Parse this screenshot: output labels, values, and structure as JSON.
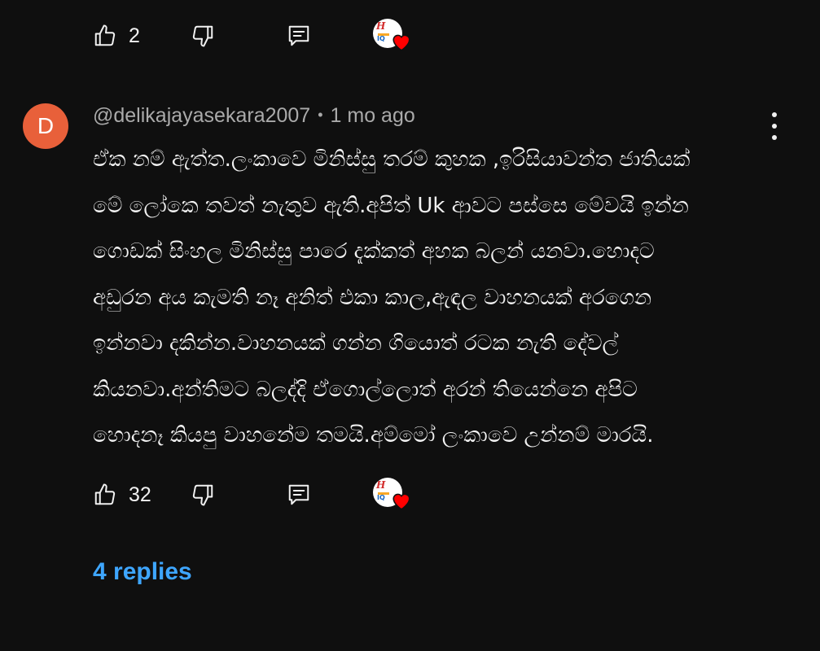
{
  "previous_comment": {
    "like_count": "2"
  },
  "comment": {
    "avatar_letter": "D",
    "author": "@delikajayasekara2007",
    "separator": "•",
    "time": "1 mo ago",
    "lines": [
      "ඒක නම් ඇත්ත.ලංකාවෙ මිනිස්සු තරම් කුහක ,ඉරිසියාවන්ත ජාතියක්",
      "මේ ලෝකෙ තවත් නැතුව ඇති.අපිත් Uk ආවට පස්සෙ මේවයි ඉන්න",
      "ගොඩක් සිංහල මිනිස්සු පාරෙ දැක්කත් අහක බලන් යනවා.හොදට",
      "අඩුරන අය කැමති නෑ අනිත් එකා කාල,ඇඳල වාහනයක් අරගෙන",
      "ඉන්නවා දකින්න.වාහනයක් ගන්න ගියොත් රටක නැති දේවල්",
      "කියනවා.අන්තිමට බලද්දි ඒගොල්ලොත් අරන් තියෙන්නෙ අපිට",
      "හොදනෑ කියපු වාහනේම තමයි.අම්මෝ ලංකාවෙ උන්නම් මාරයි."
    ],
    "like_count": "32"
  },
  "creator_heart": {
    "avatar_text": "H",
    "avatar_sub": "IQ"
  },
  "replies_label": "4 replies",
  "colors": {
    "background": "#0f0f0f",
    "text": "#f1f1f1",
    "meta": "#aaaaaa",
    "avatar": "#e8603a",
    "link": "#3ea6ff",
    "heart": "#ff0000"
  },
  "icons": {
    "like": "thumbs-up-icon",
    "dislike": "thumbs-down-icon",
    "reply": "comment-reply-icon",
    "heart": "heart-icon",
    "more": "more-vertical-icon"
  }
}
